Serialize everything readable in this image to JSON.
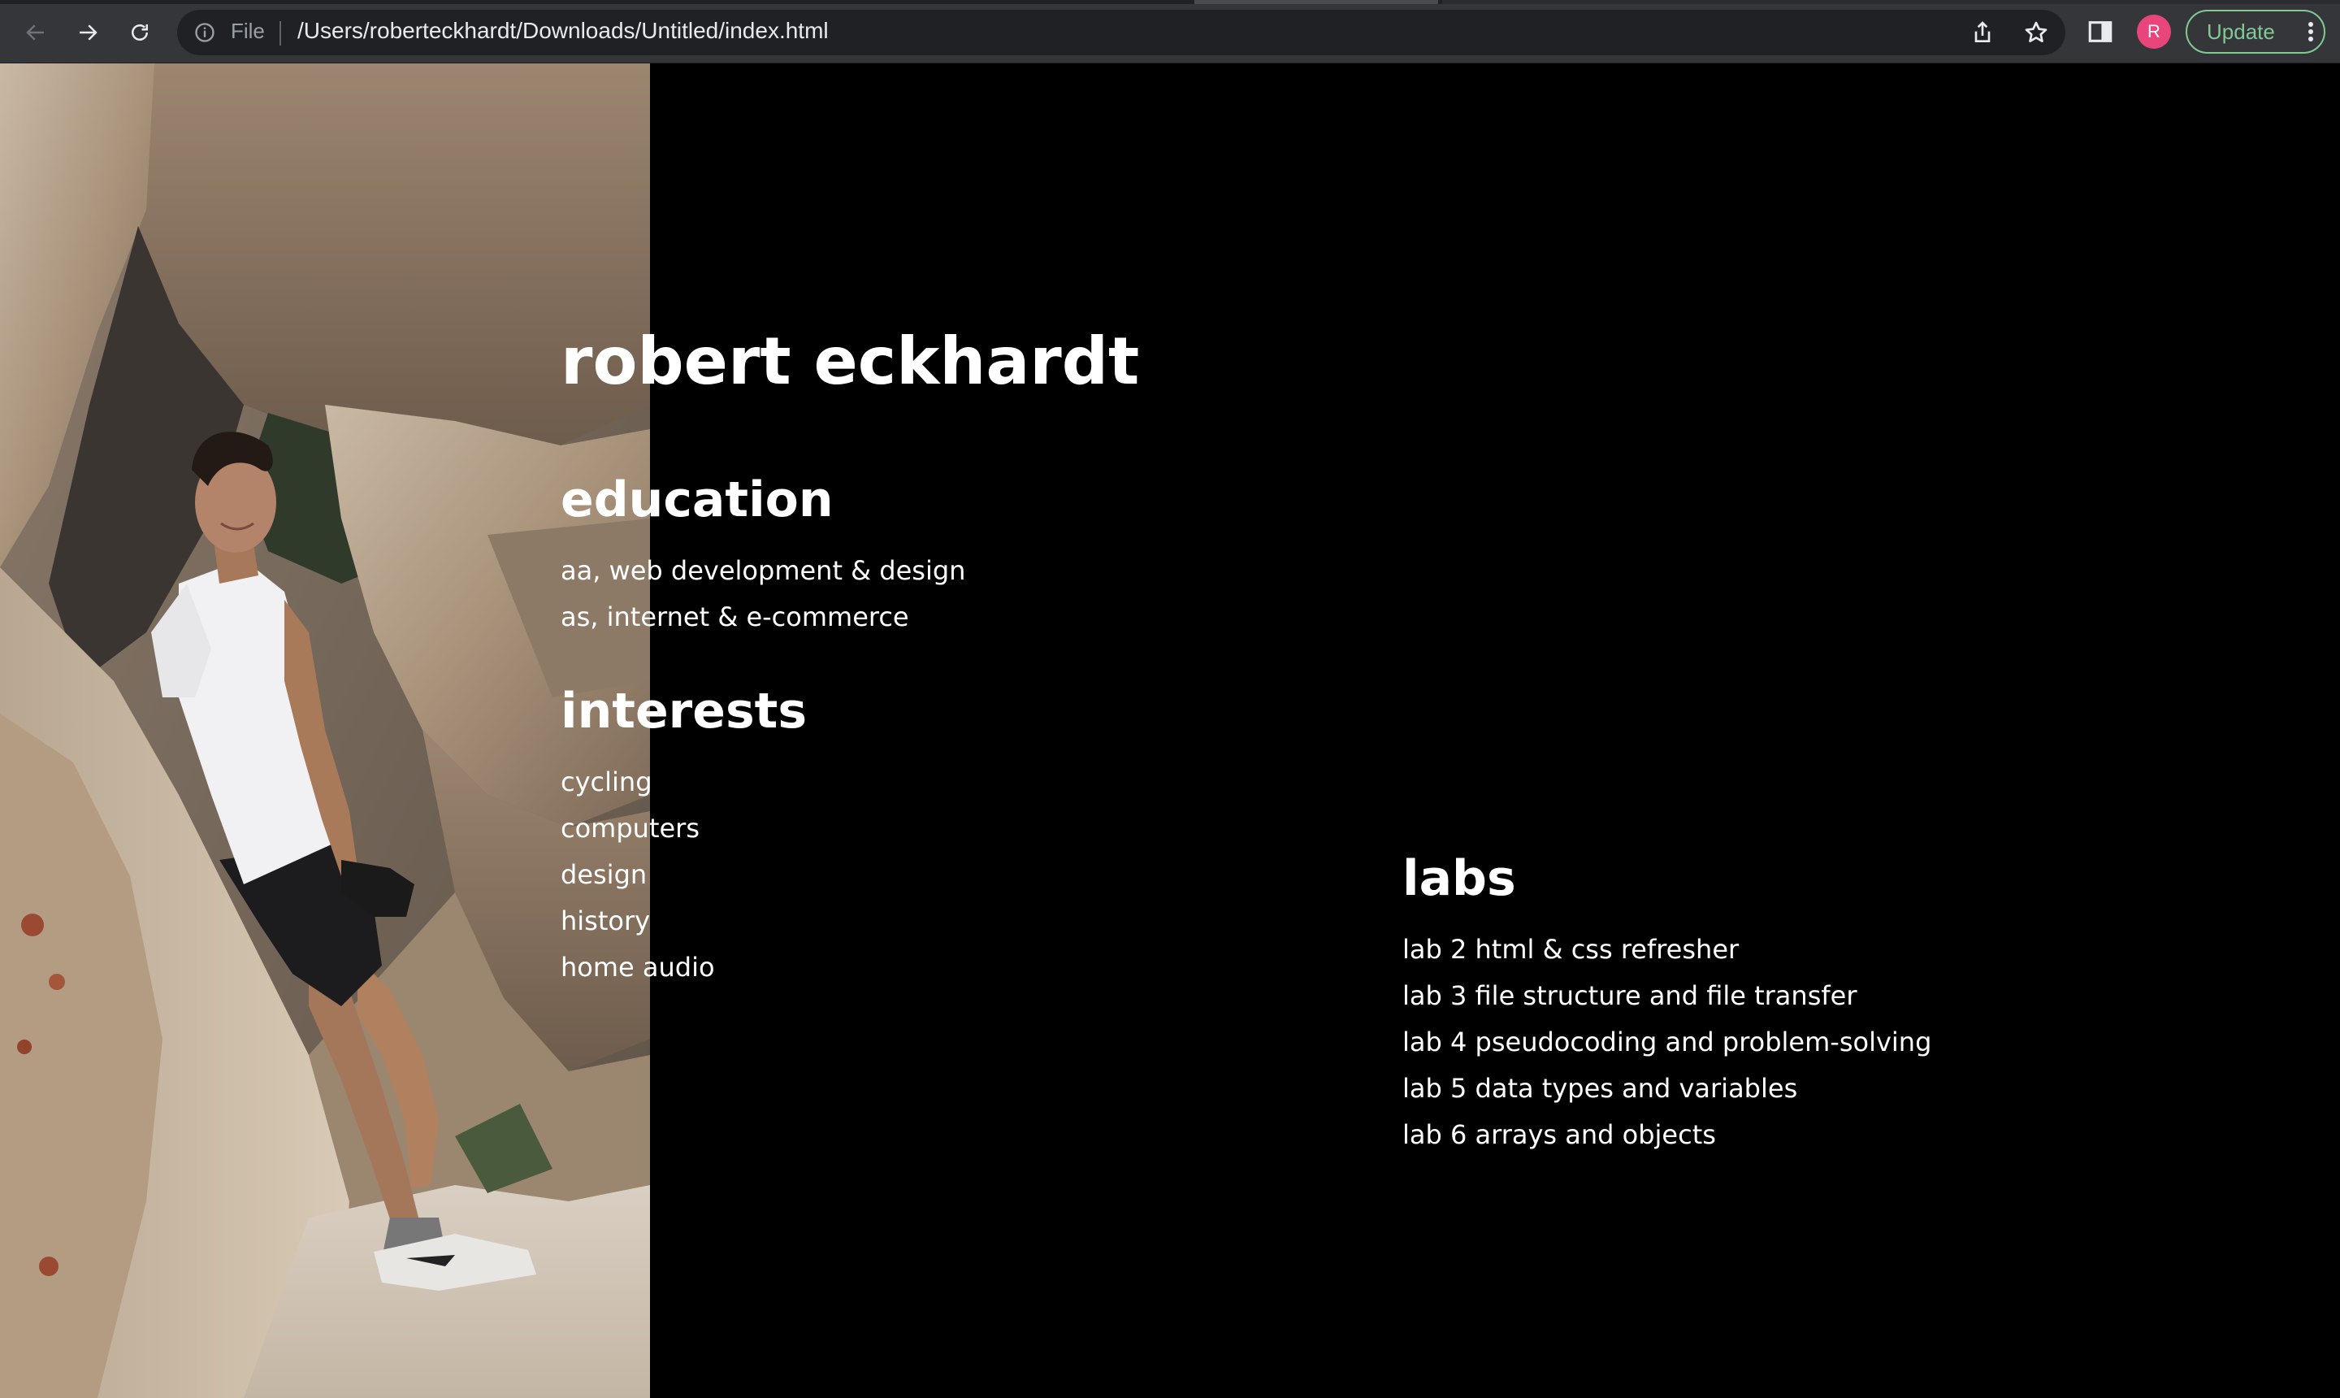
{
  "browser": {
    "scheme_label": "File",
    "url": "/Users/roberteckhardt/Downloads/Untitled/index.html",
    "profile_initial": "R",
    "update_label": "Update",
    "accent_update": "#81c995",
    "avatar_color": "#e8457a"
  },
  "page": {
    "name": "robert eckhardt",
    "education": {
      "title": "education",
      "items": [
        "aa, web development & design",
        "as, internet & e-commerce"
      ]
    },
    "interests": {
      "title": "interests",
      "items": [
        "cycling",
        "computers",
        "design",
        "history",
        "home audio"
      ]
    },
    "labs": {
      "title": "labs",
      "items": [
        "lab 2 html & css refresher",
        "lab 3 file structure and file transfer",
        "lab 4 pseudocoding and problem-solving",
        "lab 5 data types and variables",
        "lab 6 arrays and objects"
      ]
    }
  }
}
